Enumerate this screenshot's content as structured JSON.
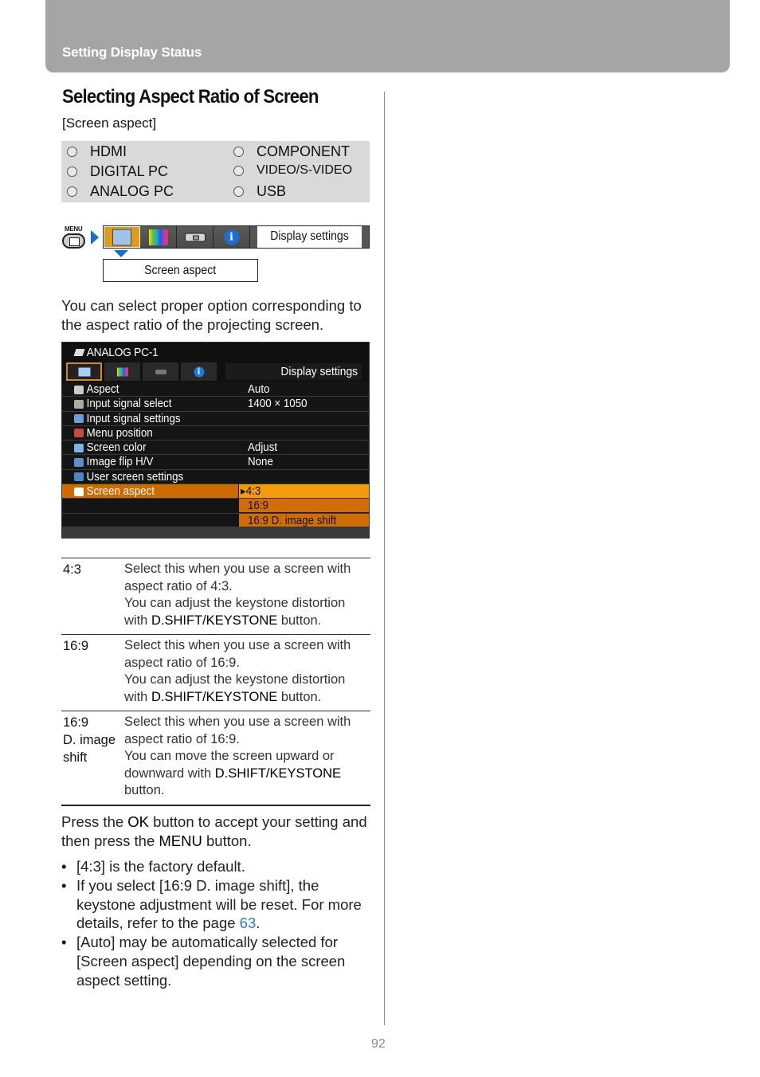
{
  "header": {
    "section_title": "Setting Display Status"
  },
  "page": {
    "title": "Selecting Aspect Ratio of Screen",
    "subtitle": "[Screen aspect]",
    "page_number": "92"
  },
  "inputs": [
    {
      "label": "HDMI"
    },
    {
      "label": "DIGITAL PC"
    },
    {
      "label": "ANALOG PC"
    },
    {
      "label": "COMPONENT"
    },
    {
      "label": "VIDEO/S-VIDEO"
    },
    {
      "label": "USB"
    }
  ],
  "menu_path": {
    "menu_button_label": "MENU",
    "tabs": [
      {
        "icon": "screen-icon",
        "active": true
      },
      {
        "icon": "color-bars-icon",
        "active": false
      },
      {
        "icon": "projector-icon",
        "active": false
      },
      {
        "icon": "info-icon",
        "active": false
      }
    ],
    "tab_title": "Display settings",
    "submenu": "Screen aspect"
  },
  "intro_text": "You can select proper option corresponding to the aspect ratio of the projecting screen.",
  "osd": {
    "source": "ANALOG PC-1",
    "info_glyph": "i",
    "title": "Display settings",
    "rows": [
      {
        "label": "Aspect",
        "value": "Auto",
        "icon_color": "#cccccc"
      },
      {
        "label": "Input signal select",
        "value": "1400 × 1050",
        "icon_color": "#aaaaaa"
      },
      {
        "label": "Input signal settings",
        "value": "",
        "icon_color": "#6a9fd8"
      },
      {
        "label": "Menu position",
        "value": "",
        "icon_color": "#c84a3a"
      },
      {
        "label": "Screen color",
        "value": "Adjust",
        "icon_color": "#7fb3e8"
      },
      {
        "label": "Image flip H/V",
        "value": "None",
        "icon_color": "#5b8fd0"
      },
      {
        "label": "User screen settings",
        "value": "",
        "icon_color": "#4d86c9"
      },
      {
        "label": "Screen aspect",
        "value": "",
        "icon_color": "#ffffff",
        "selected": true
      }
    ],
    "options": [
      {
        "label": "▸4:3",
        "highlighted": true
      },
      {
        "label": "16:9",
        "highlighted": false
      },
      {
        "label": "16:9 D. image shift",
        "highlighted": false
      }
    ]
  },
  "options_table": [
    {
      "key": [
        "4:3"
      ],
      "desc_lines": [
        "Select this when you use a screen with aspect ratio of 4:3.",
        "You can adjust the keystone distortion with "
      ],
      "button": "D.SHIFT/KEYSTONE",
      "suffix": " button."
    },
    {
      "key": [
        "16:9"
      ],
      "desc_lines": [
        "Select this when you use a screen with aspect ratio of 16:9.",
        "You can adjust the keystone distortion with "
      ],
      "button": "D.SHIFT/KEYSTONE",
      "suffix": " button."
    },
    {
      "key": [
        "16:9",
        "D. image",
        "shift"
      ],
      "desc_lines": [
        "Select this when you use a screen with aspect ratio of 16:9.",
        "You can move the screen upward or downward with "
      ],
      "button": "D.SHIFT/KEYSTONE",
      "suffix": " button."
    }
  ],
  "press_text": {
    "part1": "Press the ",
    "ok": "OK",
    "part2": " button to accept your setting and then press the ",
    "menu": "MENU",
    "part3": " button."
  },
  "notes": {
    "b1": "[4:3] is the factory default.",
    "b2_pre": "If you select [16:9 D. image shift], the keystone adjustment will be reset. For more details, refer to the page ",
    "b2_link": "63",
    "b2_post": ".",
    "b3": "[Auto] may be automatically selected for [Screen aspect] depending on the screen aspect setting."
  },
  "colors": {
    "header_band": "#a5a5a5",
    "menu_accent": "#de9b1c",
    "osd_selected": "#cf6a00",
    "link": "#2b7bd6",
    "nav_arrow": "#1a6fc4"
  }
}
